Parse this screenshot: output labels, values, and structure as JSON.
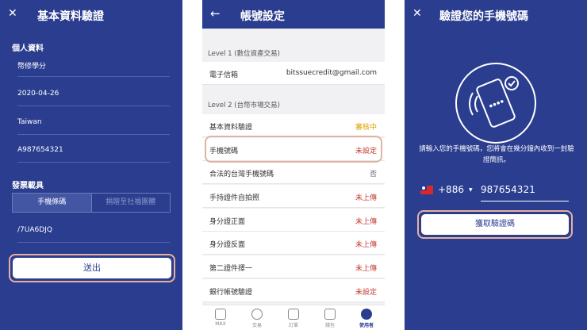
{
  "panel1": {
    "title": "基本資料驗證",
    "close_icon": "close-icon",
    "personal_section": "個人資料",
    "fields": [
      "幣修學分",
      "2020-04-26",
      "Taiwan",
      "A987654321"
    ],
    "invoice_section": "發票載具",
    "carrier_tabs": [
      "手機條碼",
      "捐贈至社福團體"
    ],
    "carrier_value": "/7UA6DJQ",
    "submit_label": "送出"
  },
  "panel2": {
    "title": "帳號設定",
    "back_icon": "back-arrow-icon",
    "level1_label": "Level 1 (數位資產交易)",
    "level1_rows": [
      {
        "label": "電子信箱",
        "value": "bitssuecredit@gmail.com"
      }
    ],
    "level2_label": "Level 2 (台幣市場交易)",
    "level2_rows": [
      {
        "label": "基本資料驗證",
        "value": "審核中",
        "status": "pending"
      },
      {
        "label": "手機號碼",
        "value": "未設定",
        "status": "unset"
      },
      {
        "label": "合法的台灣手機號碼",
        "value": "否",
        "status": "no"
      },
      {
        "label": "手持證件自拍照",
        "value": "未上傳",
        "status": "unset"
      },
      {
        "label": "身分證正面",
        "value": "未上傳",
        "status": "unset"
      },
      {
        "label": "身分證反面",
        "value": "未上傳",
        "status": "unset"
      },
      {
        "label": "第二證件擇一",
        "value": "未上傳",
        "status": "unset"
      },
      {
        "label": "銀行帳號驗證",
        "value": "未設定",
        "status": "unset"
      }
    ],
    "tabs": [
      "MAX",
      "交易",
      "訂單",
      "錢包",
      "使用者"
    ],
    "active_tab": "使用者",
    "colors": {
      "pending": "#e0a100",
      "unset": "#c0392b",
      "no": "#666666"
    }
  },
  "panel3": {
    "title": "驗證您的手機號碼",
    "close_icon": "close-icon",
    "illustration": "phone-verified-icon",
    "description": "請輸入您的手機號碼，您將會在幾分鐘內收到一封驗證簡訊。",
    "country_code": "+886",
    "phone_number": "987654321",
    "get_code_label": "獲取驗證碼"
  },
  "colors": {
    "brand_blue": "#2a3d8f",
    "highlight_ring": "#e8b09c"
  }
}
